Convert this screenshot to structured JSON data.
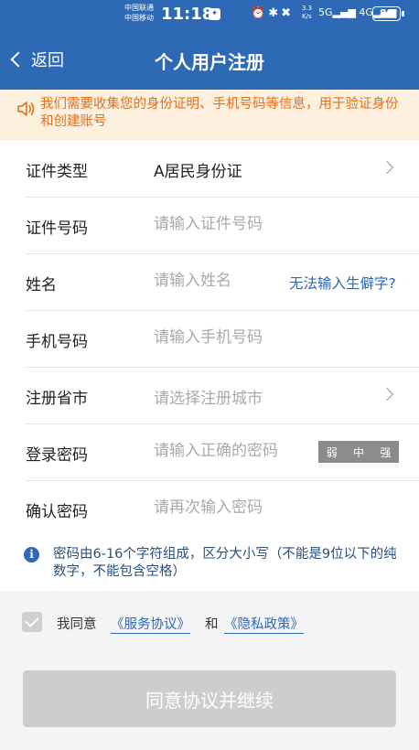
{
  "status_bar": {
    "carrier_1": "中国联通",
    "carrier_2": "中国移动",
    "time": "11:18",
    "net_speed_value": "3.3",
    "net_speed_unit": "K/s",
    "signal_5g": "5G",
    "signal_4g": "4G",
    "battery": "80"
  },
  "nav": {
    "back_label": "返回",
    "title": "个人用户注册"
  },
  "notice": {
    "text": "我们需要收集您的身份证明、手机号码等信息，用于验证身份和创建账号"
  },
  "form": {
    "id_type": {
      "label": "证件类型",
      "value": "A居民身份证"
    },
    "id_number": {
      "label": "证件号码",
      "placeholder": "请输入证件号码"
    },
    "name": {
      "label": "姓名",
      "placeholder": "请输入姓名",
      "link": "无法输入生僻字?"
    },
    "phone": {
      "label": "手机号码",
      "placeholder": "请输入手机号码"
    },
    "city": {
      "label": "注册省市",
      "placeholder": "请选择注册城市"
    },
    "password": {
      "label": "登录密码",
      "placeholder": "请输入正确的密码",
      "strength": [
        "弱",
        "中",
        "强"
      ]
    },
    "confirm": {
      "label": "确认密码",
      "placeholder": "请再次输入密码"
    }
  },
  "hint": {
    "text": "密码由6-16个字符组成，区分大小写（不能是9位以下的纯数字，不能包含空格）"
  },
  "agreement": {
    "prefix": "我同意",
    "service": "《服务协议》",
    "and": "和",
    "privacy": "《隐私政策》"
  },
  "continue_label": "同意协议并继续",
  "colors": {
    "brand": "#2d69b4",
    "notice_bg": "#fdf0df",
    "notice_text": "#e46f1d",
    "disabled_button": "#cdcdcd"
  }
}
